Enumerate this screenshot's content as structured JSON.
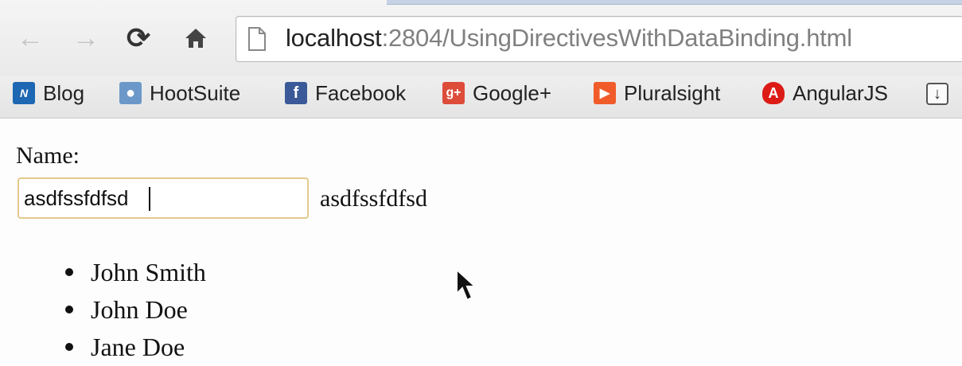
{
  "browser": {
    "url_host": "localhost",
    "url_rest": ":2804/UsingDirectivesWithDataBinding.html",
    "nav": {
      "back_icon": "arrow-left-icon",
      "forward_icon": "arrow-right-icon",
      "reload_icon": "reload-icon",
      "home_icon": "home-icon"
    },
    "bookmarks": [
      {
        "label": "Blog",
        "icon": "aspnet-icon",
        "color": "#1d67b3"
      },
      {
        "label": "HootSuite",
        "icon": "hootsuite-icon",
        "color": "#5b8fc6"
      },
      {
        "label": "Facebook",
        "icon": "facebook-icon",
        "color": "#3b5998"
      },
      {
        "label": "Google+",
        "icon": "google-plus-icon",
        "color": "#dd4b39"
      },
      {
        "label": "Pluralsight",
        "icon": "pluralsight-icon",
        "color": "#f15b2a"
      },
      {
        "label": "AngularJS",
        "icon": "angular-icon",
        "color": "#dd1b16"
      }
    ],
    "overflow_icon": "download-arrow-icon"
  },
  "page": {
    "name_label": "Name:",
    "name_value": "asdfssfdfsd",
    "bound_text": "asdfssfdfsd",
    "people": [
      "John Smith",
      "John Doe",
      "Jane Doe"
    ]
  }
}
